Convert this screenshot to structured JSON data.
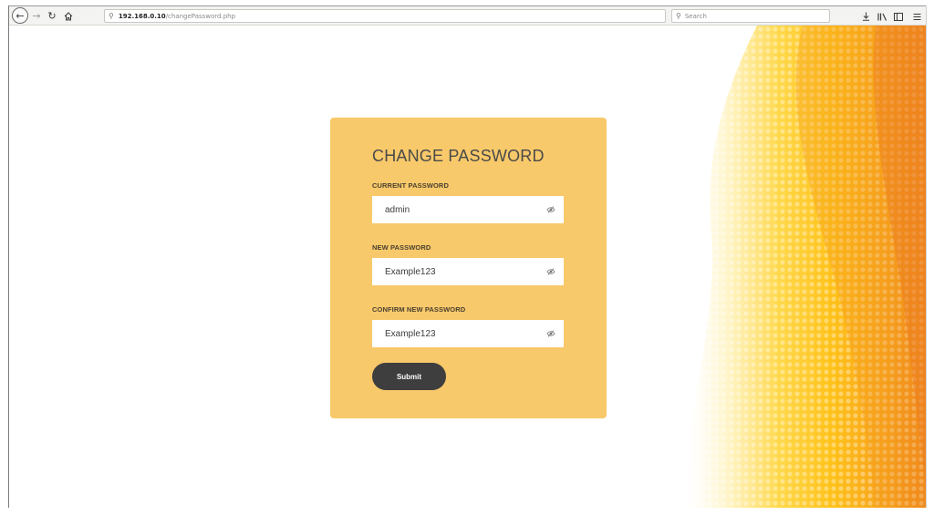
{
  "browser": {
    "url_host": "192.168.0.10",
    "url_path": "/changePassword.php",
    "search_placeholder": "Search"
  },
  "icons": {
    "back": "arrow-left-circle",
    "forward": "arrow-right",
    "reload": "reload",
    "home": "home",
    "url_info": "search-magnifier",
    "search": "search-magnifier",
    "downloads": "download-arrow",
    "library": "library-books",
    "sidebar": "sidebar-panel",
    "menu": "hamburger-menu",
    "toggle_visibility": "eye-slash"
  },
  "form": {
    "title": "CHANGE PASSWORD",
    "current": {
      "label": "CURRENT PASSWORD",
      "value": "admin"
    },
    "new": {
      "label": "NEW PASSWORD",
      "value": "Example123"
    },
    "confirm": {
      "label": "CONFIRM NEW PASSWORD",
      "value": "Example123"
    },
    "submit_label": "Submit"
  },
  "colors": {
    "card_bg": "#f8c96a",
    "button_bg": "#3e3e3e",
    "accent_orange": "#f08a1c",
    "accent_yellow": "#ffc61a"
  }
}
